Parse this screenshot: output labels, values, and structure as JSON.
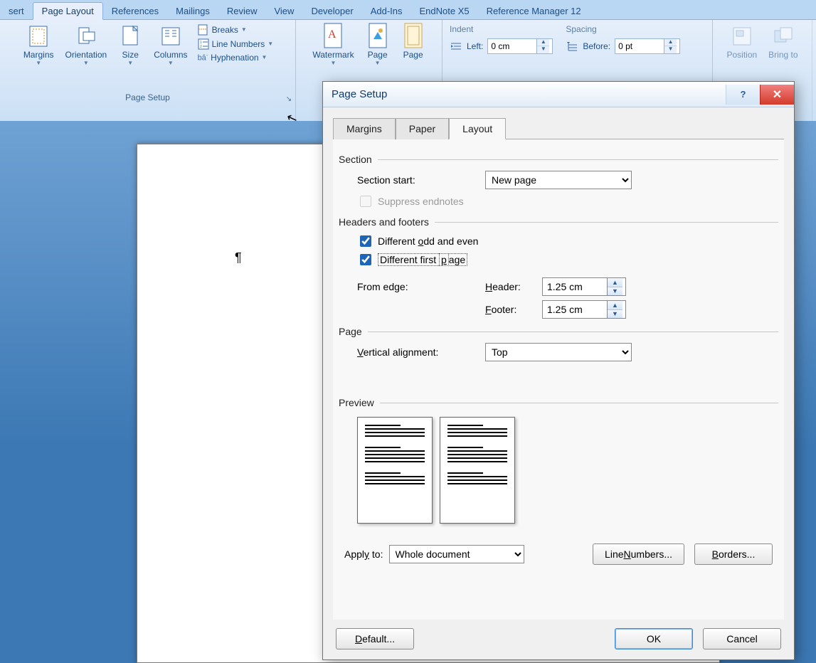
{
  "ribbon": {
    "tabs": {
      "insert": "sert",
      "pageLayout": "Page Layout",
      "references": "References",
      "mailings": "Mailings",
      "review": "Review",
      "view": "View",
      "developer": "Developer",
      "addins": "Add-Ins",
      "endnote": "EndNote X5",
      "refmanager": "Reference Manager 12"
    },
    "pageSetup": {
      "margins": "Margins",
      "orientation": "Orientation",
      "size": "Size",
      "columns": "Columns",
      "breaks": "Breaks",
      "lineNumbers": "Line Numbers",
      "hyphenation": "Hyphenation",
      "groupLabel": "Page Setup"
    },
    "pageBG": {
      "watermark": "Watermark",
      "page1": "Page",
      "page2": "Page"
    },
    "paragraph": {
      "indentHead": "Indent",
      "leftLabel": "Left:",
      "leftValue": "0 cm",
      "spacingHead": "Spacing",
      "beforeLabel": "Before:",
      "beforeValue": "0 pt"
    },
    "arrange": {
      "position": "Position",
      "bring": "Bring to"
    }
  },
  "dialog": {
    "title": "Page Setup",
    "tabs": {
      "margins": "Margins",
      "paper": "Paper",
      "layout": "Layout"
    },
    "section": {
      "heading": "Section",
      "startLabel": "Section start:",
      "startValue": "New page",
      "suppress": "Suppress endnotes"
    },
    "hf": {
      "heading": "Headers and footers",
      "diffOE": "Different odd and even",
      "diffFirst": "Different first page",
      "fromEdge": "From edge:",
      "headerLabel": "Header:",
      "headerValue": "1.25 cm",
      "footerLabel": "Footer:",
      "footerValue": "1.25 cm"
    },
    "page": {
      "heading": "Page",
      "valignLabel": "Vertical alignment:",
      "valignValue": "Top"
    },
    "preview": {
      "heading": "Preview"
    },
    "apply": {
      "label": "Apply to:",
      "value": "Whole document",
      "lineNumbers": "Line Numbers...",
      "borders": "Borders..."
    },
    "footer": {
      "default": "Default...",
      "ok": "OK",
      "cancel": "Cancel"
    }
  }
}
